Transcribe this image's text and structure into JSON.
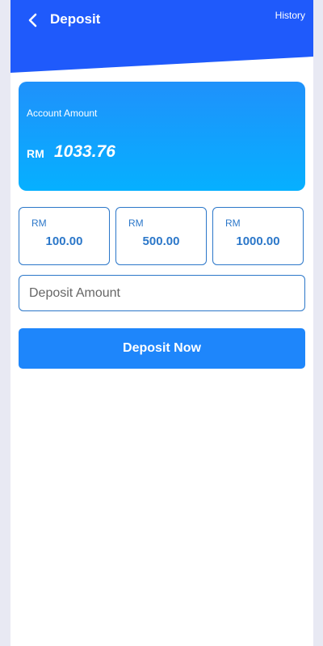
{
  "header": {
    "title": "Deposit",
    "history_label": "History",
    "back_icon": "chevron-left-icon",
    "color": "#1f5afb"
  },
  "account": {
    "label": "Account Amount",
    "currency": "RM",
    "amount": "1033.76",
    "gradient_top": "#1f91fb",
    "gradient_bottom": "#06b0ff"
  },
  "quick_amounts": [
    {
      "currency": "RM",
      "value": "100.00"
    },
    {
      "currency": "RM",
      "value": "500.00"
    },
    {
      "currency": "RM",
      "value": "1000.00"
    }
  ],
  "deposit_input": {
    "placeholder": "Deposit Amount",
    "value": ""
  },
  "deposit_button": {
    "label": "Deposit Now",
    "color": "#1e86fb"
  },
  "colors": {
    "accent": "#2b77c9",
    "page_background": "#e8e9f3"
  }
}
